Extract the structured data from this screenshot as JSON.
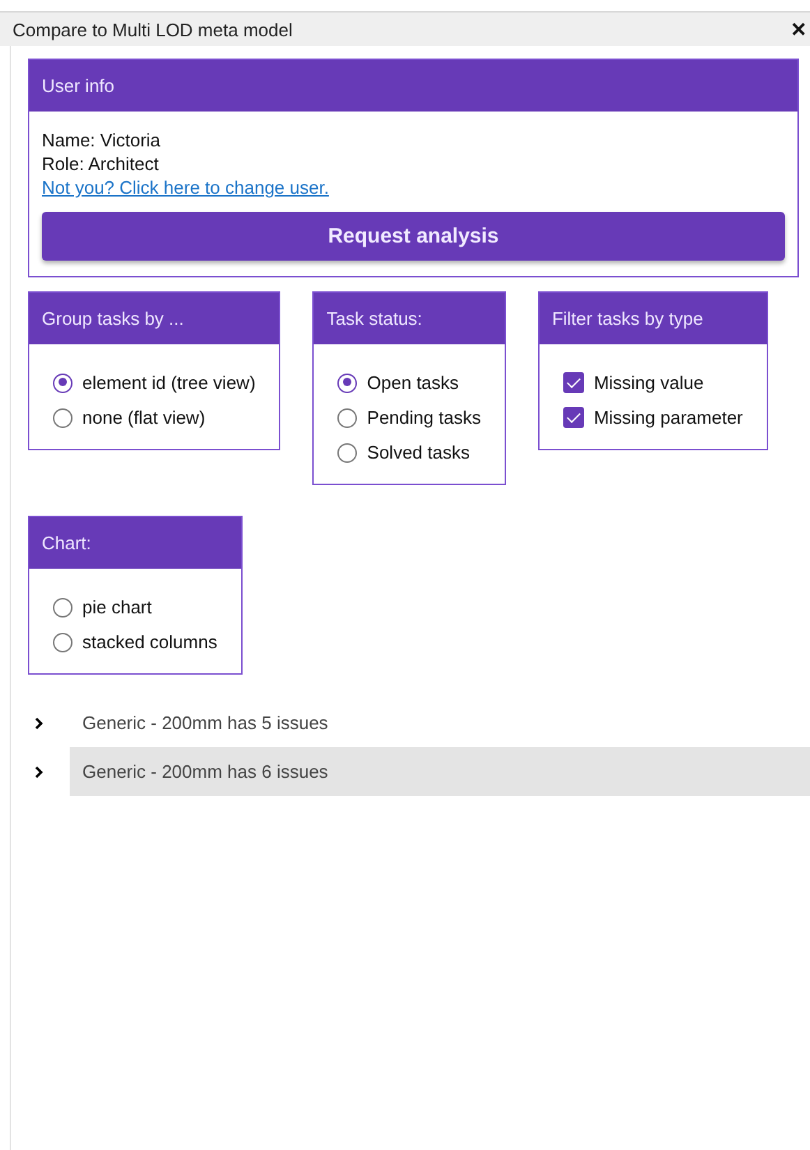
{
  "window": {
    "title": "Compare to Multi LOD meta model",
    "close": "✕"
  },
  "user_info": {
    "title": "User info",
    "lines": [
      "Name: Victoria",
      "Role: Architect"
    ],
    "link": "Not you? Click here to change user.",
    "button": "Request analysis"
  },
  "panels": [
    {
      "title": "Group tasks by ...",
      "kind": "radio",
      "options": [
        {
          "label": "element id (tree view)",
          "selected": true
        },
        {
          "label": "none (flat view)",
          "selected": false
        }
      ]
    },
    {
      "title": "Task status:",
      "kind": "radio",
      "options": [
        {
          "label": "Open tasks",
          "selected": true
        },
        {
          "label": "Pending tasks",
          "selected": false
        },
        {
          "label": "Solved tasks",
          "selected": false
        }
      ]
    },
    {
      "title": "Filter tasks by type",
      "kind": "checkbox",
      "options": [
        {
          "label": "Missing value",
          "selected": true
        },
        {
          "label": "Missing parameter",
          "selected": true
        }
      ]
    },
    {
      "title": "Chart:",
      "kind": "radio",
      "options": [
        {
          "label": "pie chart",
          "selected": false
        },
        {
          "label": "stacked columns",
          "selected": false
        }
      ]
    }
  ],
  "tree": [
    {
      "label": "Generic - 200mm has 5 issues",
      "expanded": false,
      "selected": false
    },
    {
      "label": "Generic - 200mm has 6 issues",
      "expanded": false,
      "selected": true
    }
  ]
}
